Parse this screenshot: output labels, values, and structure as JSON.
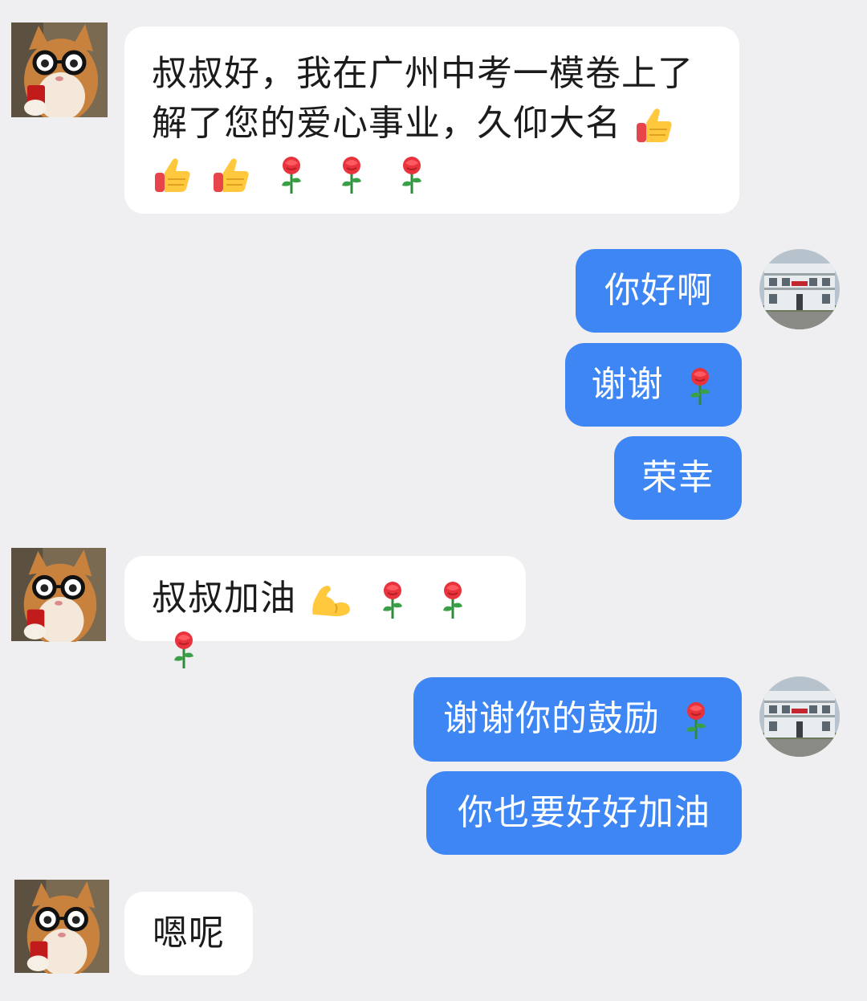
{
  "messages": [
    {
      "sender": "other",
      "text": "叔叔好，我在广州中考一模卷上了解了您的爱心事业，久仰大名",
      "emojis": [
        "thumbs-up",
        "thumbs-up",
        "thumbs-up",
        "rose",
        "rose",
        "rose"
      ]
    },
    {
      "sender": "me",
      "text": "你好啊",
      "emojis": []
    },
    {
      "sender": "me",
      "text": "谢谢",
      "emojis": [
        "rose"
      ]
    },
    {
      "sender": "me",
      "text": "荣幸",
      "emojis": []
    },
    {
      "sender": "other",
      "text": "叔叔加油",
      "emojis": [
        "flexed-biceps",
        "rose",
        "rose",
        "rose"
      ]
    },
    {
      "sender": "me",
      "text": "谢谢你的鼓励",
      "emojis": [
        "rose"
      ]
    },
    {
      "sender": "me",
      "text": "你也要好好加油",
      "emojis": []
    },
    {
      "sender": "other",
      "text": "嗯呢",
      "emojis": []
    }
  ],
  "colors": {
    "background": "#efeff1",
    "incoming_bubble": "#ffffff",
    "outgoing_bubble": "#3d86f4",
    "incoming_text": "#1b1b1b",
    "outgoing_text": "#ffffff"
  }
}
